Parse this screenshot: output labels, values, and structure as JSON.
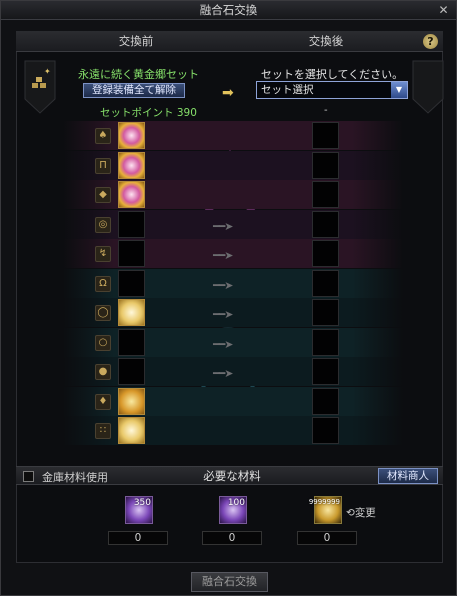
{
  "window": {
    "title": "融合石交換"
  },
  "header": {
    "before": "交換前",
    "after": "交換後",
    "help": "?"
  },
  "left": {
    "set_name": "永遠に続く黄金郷セット",
    "unequip_label": "登録装備全て解除",
    "set_points": "セットポイント 390"
  },
  "right": {
    "select_label": "セットを選択してください。",
    "select_value": "セット選択",
    "points": "-"
  },
  "rows": [
    {
      "slot": "head-icon",
      "filled": true,
      "style": "pink"
    },
    {
      "slot": "pants-icon",
      "filled": true,
      "style": "pink"
    },
    {
      "slot": "shoulder-icon",
      "filled": true,
      "style": "pink"
    },
    {
      "slot": "belt-icon",
      "filled": false
    },
    {
      "slot": "shoes-icon",
      "filled": false
    },
    {
      "slot": "necklace-icon",
      "filled": false
    },
    {
      "slot": "bracelet-icon",
      "filled": true,
      "style": "pale"
    },
    {
      "slot": "ring-icon",
      "filled": false
    },
    {
      "slot": "aux-icon",
      "filled": false
    },
    {
      "slot": "magic-stone-icon",
      "filled": true,
      "style": "gold"
    },
    {
      "slot": "earring-icon",
      "filled": true,
      "style": "pale"
    }
  ],
  "materials_bar": {
    "checkbox_label": "金庫材料使用",
    "title": "必要な材料",
    "merchant_button": "材料商人"
  },
  "materials": [
    {
      "count": "350",
      "value": "0",
      "kind": "purple"
    },
    {
      "count": "100",
      "value": "0",
      "kind": "purple"
    },
    {
      "count": "9999999",
      "value": "0",
      "kind": "gold"
    }
  ],
  "change_label": "変更",
  "fuse_button": "融合石交換"
}
